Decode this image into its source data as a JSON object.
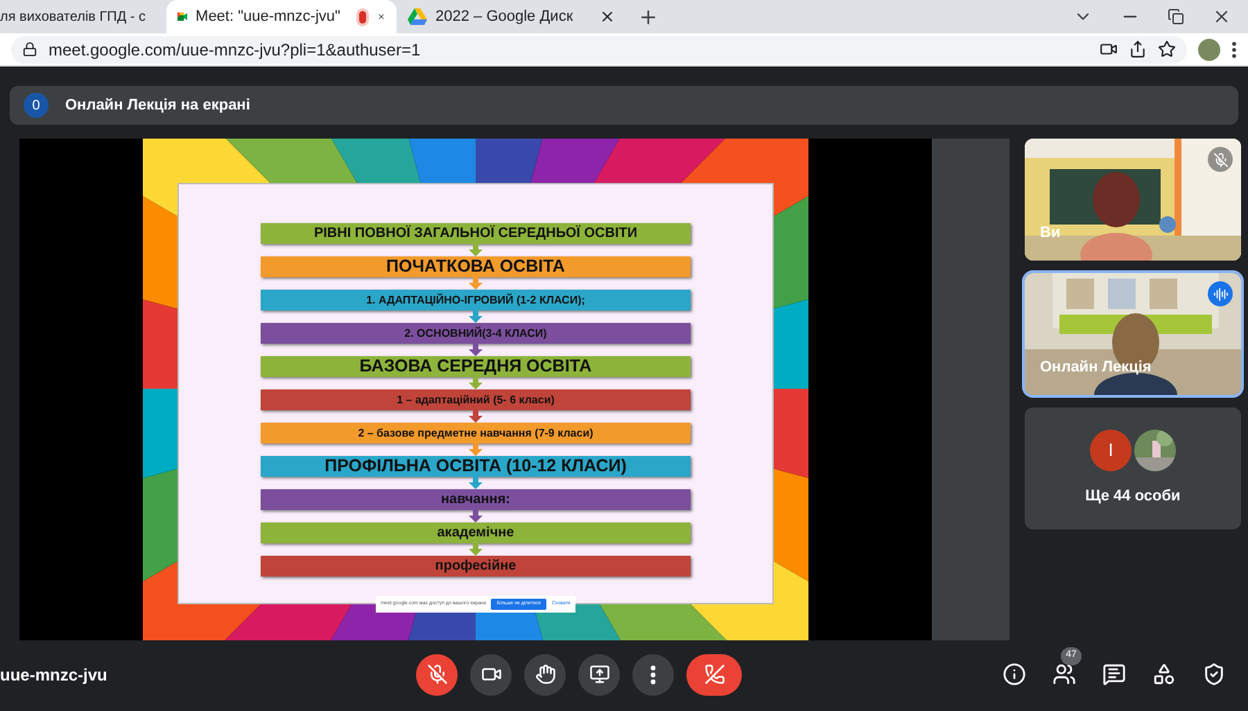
{
  "browser": {
    "tabs": [
      {
        "title": "ля вихователів ГПД - с",
        "selected": false,
        "recording": false
      },
      {
        "title": "Meet: \"uue-mnzc-jvu\"",
        "selected": true,
        "recording": true
      },
      {
        "title": "2022 – Google Диск",
        "selected": false,
        "recording": false
      }
    ],
    "url": "meet.google.com/uue-mnzc-jvu?pli=1&authuser=1"
  },
  "presentation": {
    "count": "0",
    "title": "Онлайн Лекція на екрані"
  },
  "slide": {
    "rows": [
      {
        "text": "РІВНІ ПОВНОЇ  ЗАГАЛЬНОЇ СЕРЕДНЬОЇ ОСВІТИ",
        "kind": "title",
        "color": "#8db33a"
      },
      {
        "text": "ПОЧАТКОВА ОСВІТА",
        "kind": "heading",
        "color": "#f39a2c"
      },
      {
        "text": "1. АДАПТАЦІЙНО-ІГРОВИЙ (1-2 КЛАСИ);",
        "kind": "item",
        "color": "#2aa6c9"
      },
      {
        "text": "2. ОСНОВНИЙ(3-4 КЛАСИ)",
        "kind": "item",
        "color": "#7b4f9e"
      },
      {
        "text": "БАЗОВА СЕРЕДНЯ ОСВІТА",
        "kind": "heading",
        "color": "#8db33a"
      },
      {
        "text": "1 – адаптаційний (5- 6 класи)",
        "kind": "item",
        "color": "#c0443a"
      },
      {
        "text": "2 – базове предметне навчання (7-9 класи)",
        "kind": "item",
        "color": "#f39a2c"
      },
      {
        "text": "ПРОФІЛЬНА ОСВІТА (10-12 КЛАСИ)",
        "kind": "heading",
        "color": "#2aa6c9"
      },
      {
        "text": "навчання:",
        "kind": "title",
        "color": "#7b4f9e"
      },
      {
        "text": "академічне",
        "kind": "title",
        "color": "#8db33a"
      },
      {
        "text": "професійне",
        "kind": "title",
        "color": "#c0443a"
      }
    ],
    "share_bar": {
      "message": "meet.google.com має доступ до вашого екрана",
      "stop": "Більше не ділитися",
      "hide": "Сховати"
    }
  },
  "participants": [
    {
      "name": "Ви",
      "muted": true,
      "speaking": false
    },
    {
      "name": "Онлайн Лекція",
      "muted": false,
      "speaking": true
    }
  ],
  "others": {
    "initial": "I",
    "label": "Ще 44 особи"
  },
  "meeting_code": "uue-mnzc-jvu",
  "controls": {
    "mic_on": false,
    "camera_on": true
  },
  "people_count": "47"
}
